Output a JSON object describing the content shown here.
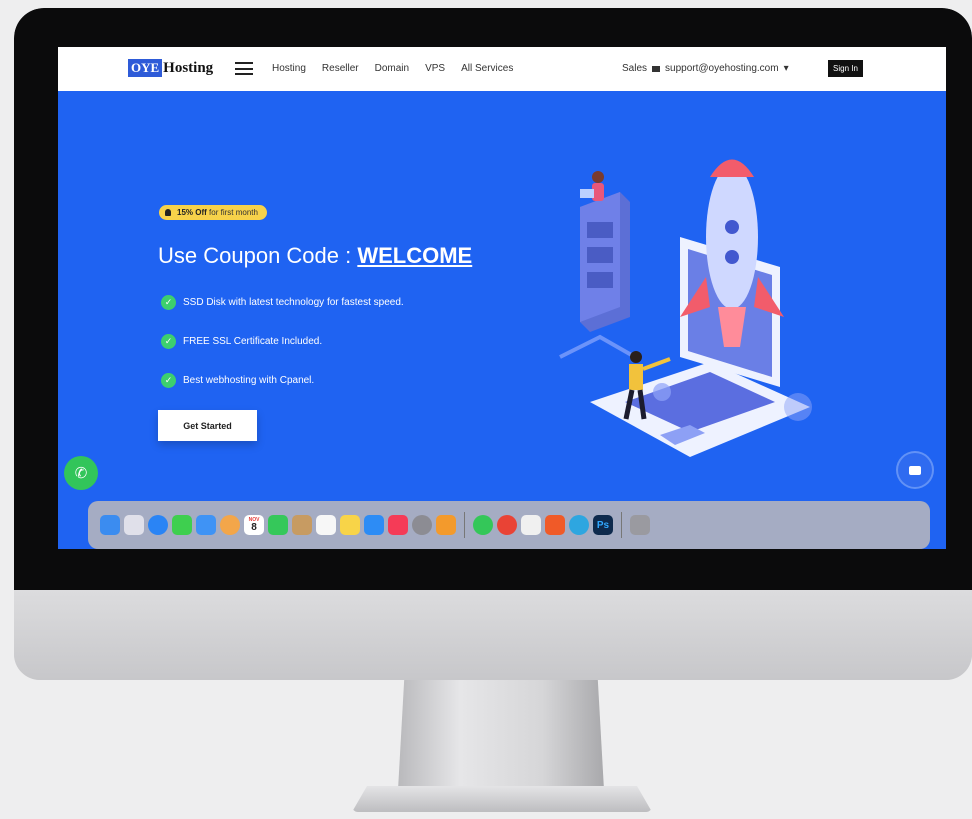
{
  "navbar": {
    "logo_badge": "OYE",
    "logo_text": "Hosting",
    "links": [
      "Hosting",
      "Reseller",
      "Domain",
      "VPS",
      "All Services"
    ],
    "sales_label": "Sales",
    "email": "support@oyehosting.com",
    "email_caret": "▾",
    "signin_label": "Sign In"
  },
  "hero": {
    "promo_bold": "15% Off",
    "promo_text": "for first month",
    "headline_prefix": "Use Coupon Code : ",
    "coupon_code": "WELCOME",
    "features": [
      "SSD Disk with latest technology for fastest speed.",
      "FREE SSL Certificate Included.",
      "Best webhosting with Cpanel."
    ],
    "cta_label": "Get Started"
  },
  "widgets": {
    "whatsapp_icon": "whatsapp-icon",
    "chat_icon": "chat-icon"
  },
  "dock": {
    "calendar_month": "NOV",
    "calendar_day": "8",
    "ps_label": "Ps",
    "icons": [
      {
        "name": "finder-icon",
        "color": "#3b8cf0"
      },
      {
        "name": "launchpad-icon",
        "color": "#e9e9ef"
      },
      {
        "name": "safari-icon",
        "color": "#2a84f5"
      },
      {
        "name": "messages-icon",
        "color": "#3ecf4f"
      },
      {
        "name": "mail-icon",
        "color": "#3f93f5"
      },
      {
        "name": "photos-icon",
        "color": "#f3a64a"
      },
      {
        "name": "calendar-icon",
        "color": "#ffffff"
      },
      {
        "name": "facetime-icon",
        "color": "#35c85a"
      },
      {
        "name": "contacts-icon",
        "color": "#c79b62"
      },
      {
        "name": "reminders-icon",
        "color": "#f7f7f7"
      },
      {
        "name": "notes-icon",
        "color": "#f8d448"
      },
      {
        "name": "app-store-icon",
        "color": "#2d8cf5"
      },
      {
        "name": "music-icon",
        "color": "#f53b57"
      },
      {
        "name": "settings-icon",
        "color": "#8c8c93"
      },
      {
        "name": "pages-icon",
        "color": "#f39a2c"
      },
      {
        "name": "whatsapp-icon",
        "color": "#34c759"
      },
      {
        "name": "chrome-icon",
        "color": "#e94335"
      },
      {
        "name": "textedit-icon",
        "color": "#f0f0f0"
      },
      {
        "name": "brave-icon",
        "color": "#f05a28"
      },
      {
        "name": "telegram-icon",
        "color": "#2ea6e0"
      },
      {
        "name": "photoshop-icon",
        "color": "#0e2a4d"
      },
      {
        "name": "trash-icon",
        "color": "#9a9aa0"
      }
    ]
  }
}
